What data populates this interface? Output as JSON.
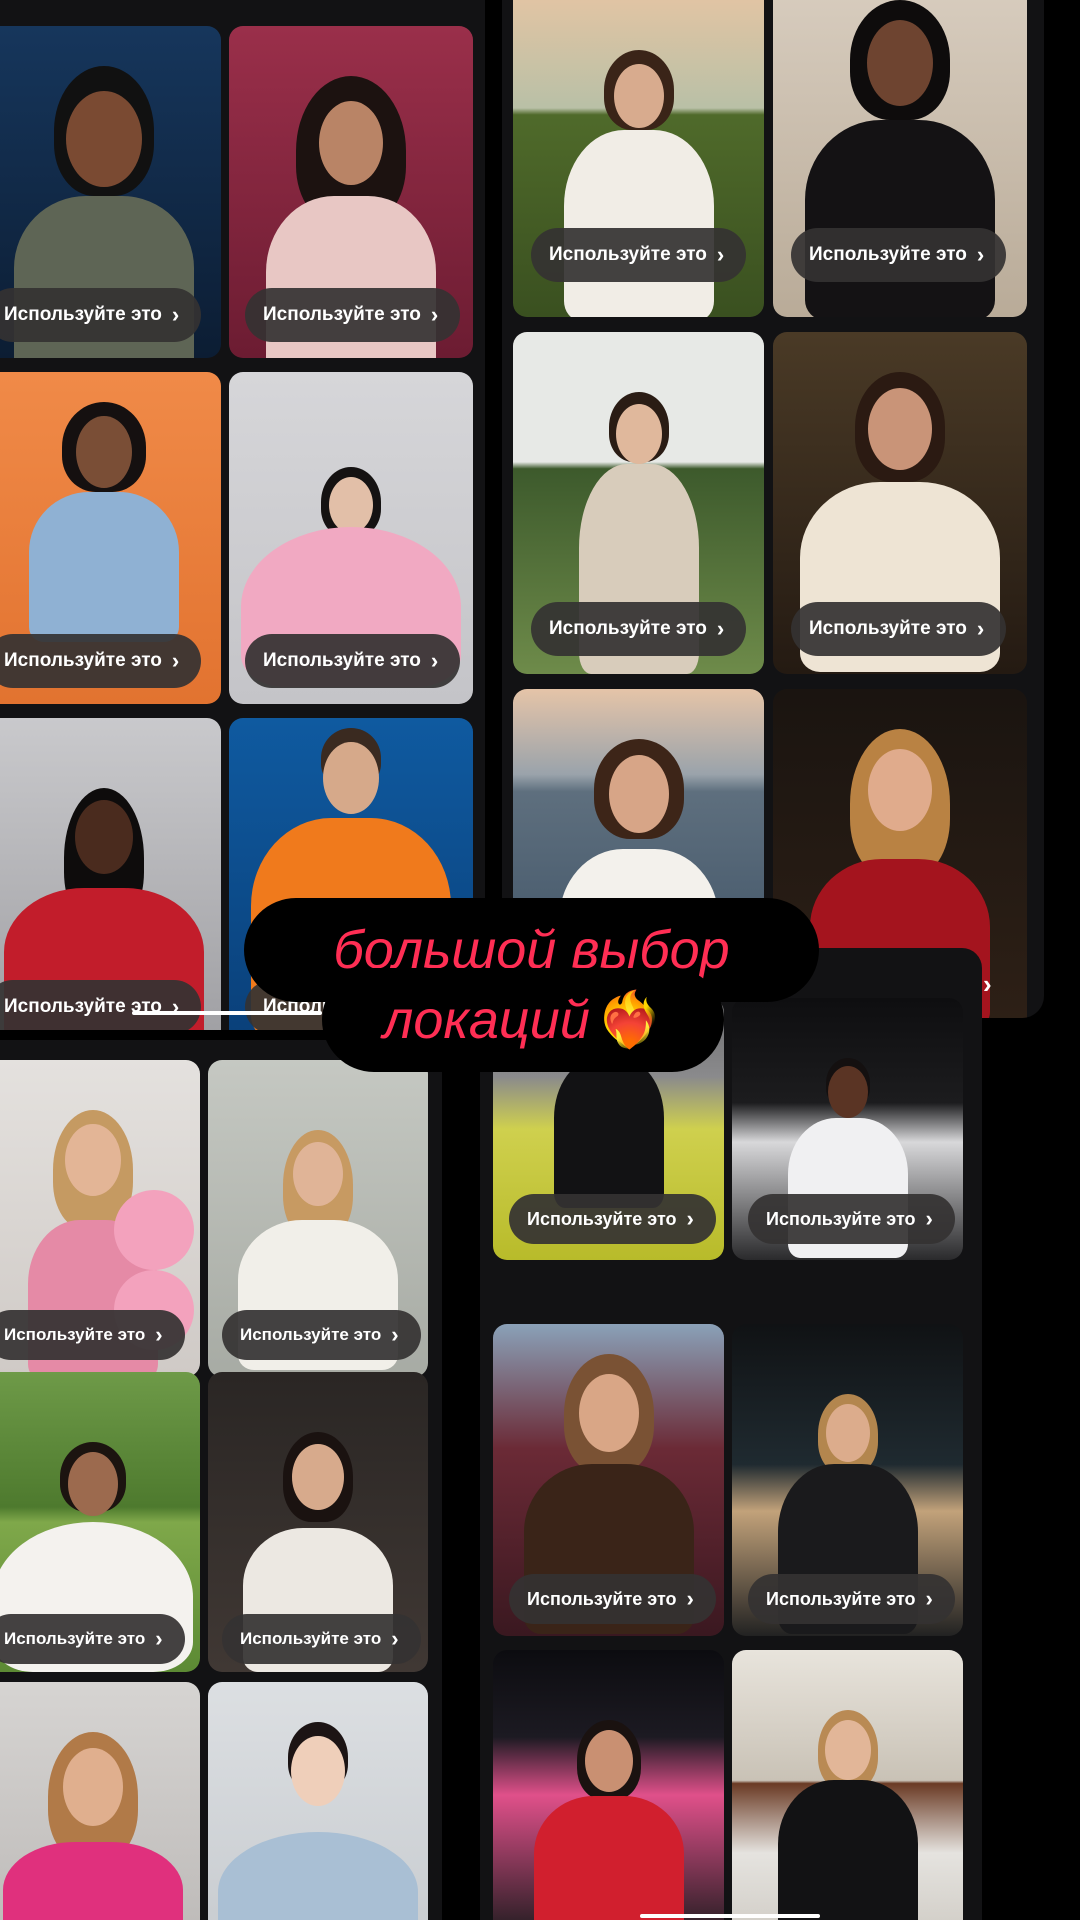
{
  "use_button_label": "Используйте это",
  "chevron_glyph": "›",
  "caption": {
    "line1": "большой выбор",
    "line2": "локаций",
    "emoji": "❤️‍🔥"
  },
  "colors": {
    "caption_text": "#ff2e54",
    "pill_bg": "#343232",
    "panel_bg": "#121214"
  }
}
